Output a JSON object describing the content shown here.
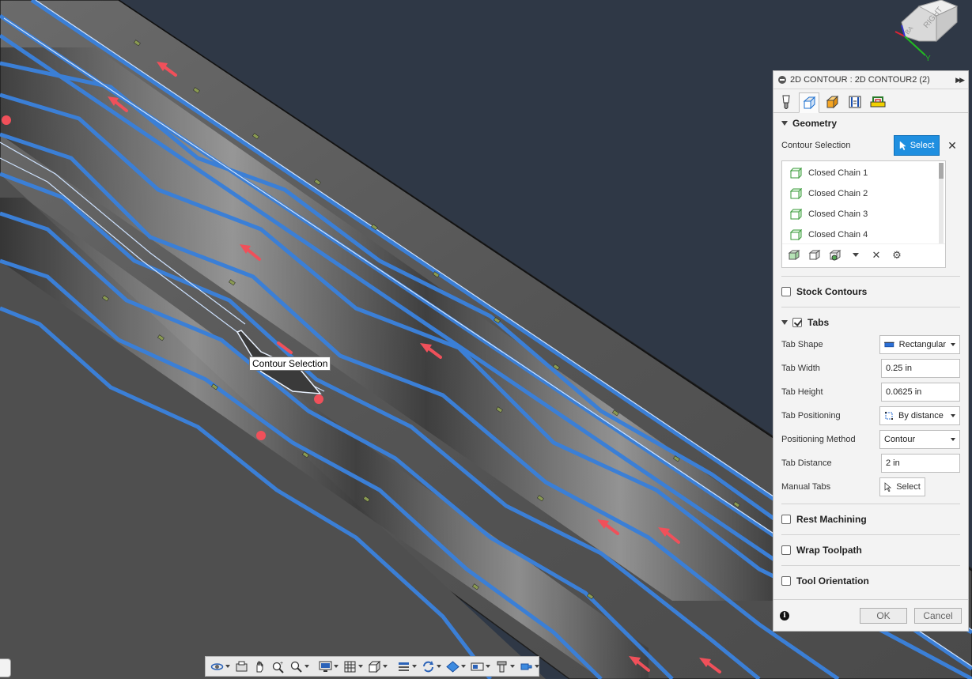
{
  "viewport": {
    "tooltip": "Contour Selection",
    "colors": {
      "background": "#2f3846",
      "stock_face": "#5f5f5f",
      "contour": "#3b7fd6",
      "arrow": "#f0505a",
      "highlight": "#dfeeff"
    }
  },
  "viewcube": {
    "face_label": "RIGHT",
    "side_label": "BA",
    "axis_label": "Y"
  },
  "panel": {
    "title": "2D CONTOUR : 2D CONTOUR2 (2)",
    "tabs": [
      "tool-icon",
      "geometry-icon",
      "heights-icon",
      "passes-icon",
      "linking-icon"
    ],
    "geometry": {
      "heading": "Geometry",
      "contour_selection_label": "Contour Selection",
      "select_label": "Select",
      "chains": [
        "Closed Chain 1",
        "Closed Chain 2",
        "Closed Chain 3",
        "Closed Chain 4"
      ]
    },
    "stock_contours": {
      "heading": "Stock Contours",
      "checked": false
    },
    "tabs_section": {
      "heading": "Tabs",
      "checked": true,
      "tab_shape": {
        "label": "Tab Shape",
        "value": "Rectangular"
      },
      "tab_width": {
        "label": "Tab Width",
        "value": "0.25 in"
      },
      "tab_height": {
        "label": "Tab Height",
        "value": "0.0625 in"
      },
      "tab_positioning": {
        "label": "Tab Positioning",
        "value": "By distance"
      },
      "positioning_method": {
        "label": "Positioning Method",
        "value": "Contour"
      },
      "tab_distance": {
        "label": "Tab Distance",
        "value": "2 in"
      },
      "manual_tabs": {
        "label": "Manual Tabs",
        "button": "Select"
      }
    },
    "rest_machining": {
      "heading": "Rest Machining",
      "checked": false
    },
    "wrap_toolpath": {
      "heading": "Wrap Toolpath",
      "checked": false
    },
    "tool_orientation": {
      "heading": "Tool Orientation",
      "checked": false
    },
    "footer": {
      "ok": "OK",
      "cancel": "Cancel",
      "info": "i"
    }
  },
  "toolbar": {
    "items": [
      "orbit-icon",
      "look-at-icon",
      "pan-icon",
      "zoom-icon",
      "fit-icon",
      "display-settings-icon",
      "grid-icon",
      "viewports-icon",
      "section-icon",
      "refresh-icon",
      "material-icon",
      "rendering-icon",
      "tool-display-icon",
      "environment-icon"
    ]
  }
}
